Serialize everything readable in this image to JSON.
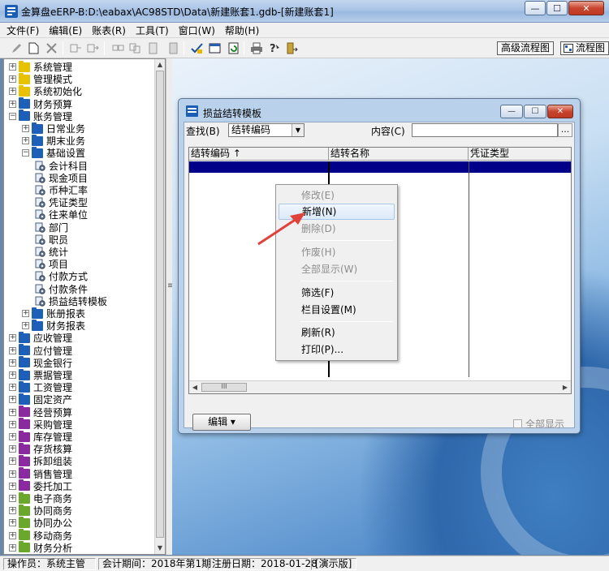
{
  "window": {
    "title": "金算盘eERP-B:D:\\eabax\\AC98STD\\Data\\新建账套1.gdb-[新建账套1]",
    "min_label": "—",
    "max_label": "☐",
    "close_label": "✕"
  },
  "menu": {
    "items": [
      {
        "label": "文件(F)"
      },
      {
        "label": "编辑(E)"
      },
      {
        "label": "账表(R)"
      },
      {
        "label": "工具(T)"
      },
      {
        "label": "窗口(W)"
      },
      {
        "label": "帮助(H)"
      }
    ]
  },
  "toolbar": {
    "advanced_flow_label": "高级流程图",
    "flow_label": "流程图"
  },
  "tree": {
    "items": [
      {
        "label": "系统管理",
        "color": "#e8c200",
        "expanded": false,
        "level": 0
      },
      {
        "label": "管理模式",
        "color": "#e8c200",
        "expanded": false,
        "level": 0
      },
      {
        "label": "系统初始化",
        "color": "#e8c200",
        "expanded": false,
        "level": 0
      },
      {
        "label": "财务预算",
        "color": "#1e5fb8",
        "expanded": false,
        "level": 0
      },
      {
        "label": "账务管理",
        "color": "#1e5fb8",
        "expanded": true,
        "level": 0
      },
      {
        "label": "日常业务",
        "color": "#1e5fb8",
        "expanded": false,
        "level": 1
      },
      {
        "label": "期末业务",
        "color": "#1e5fb8",
        "expanded": false,
        "level": 1
      },
      {
        "label": "基础设置",
        "color": "#1e5fb8",
        "expanded": true,
        "level": 1
      },
      {
        "label": "会计科目",
        "level": 2
      },
      {
        "label": "现金项目",
        "level": 2
      },
      {
        "label": "币种汇率",
        "level": 2
      },
      {
        "label": "凭证类型",
        "level": 2
      },
      {
        "label": "往来单位",
        "level": 2
      },
      {
        "label": "部门",
        "level": 2
      },
      {
        "label": "职员",
        "level": 2
      },
      {
        "label": "统计",
        "level": 2
      },
      {
        "label": "项目",
        "level": 2
      },
      {
        "label": "付款方式",
        "level": 2
      },
      {
        "label": "付款条件",
        "level": 2
      },
      {
        "label": "损益结转模板",
        "level": 2
      },
      {
        "label": "账册报表",
        "color": "#1e5fb8",
        "expanded": false,
        "level": 1
      },
      {
        "label": "财务报表",
        "color": "#1e5fb8",
        "expanded": false,
        "level": 1
      },
      {
        "label": "应收管理",
        "color": "#1e5fb8",
        "expanded": false,
        "level": 0
      },
      {
        "label": "应付管理",
        "color": "#1e5fb8",
        "expanded": false,
        "level": 0
      },
      {
        "label": "现金银行",
        "color": "#1e5fb8",
        "expanded": false,
        "level": 0
      },
      {
        "label": "票据管理",
        "color": "#1e5fb8",
        "expanded": false,
        "level": 0
      },
      {
        "label": "工资管理",
        "color": "#1e5fb8",
        "expanded": false,
        "level": 0
      },
      {
        "label": "固定资产",
        "color": "#1e5fb8",
        "expanded": false,
        "level": 0
      },
      {
        "label": "经营预算",
        "color": "#8b2aa0",
        "expanded": false,
        "level": 0
      },
      {
        "label": "采购管理",
        "color": "#8b2aa0",
        "expanded": false,
        "level": 0
      },
      {
        "label": "库存管理",
        "color": "#8b2aa0",
        "expanded": false,
        "level": 0
      },
      {
        "label": "存货核算",
        "color": "#8b2aa0",
        "expanded": false,
        "level": 0
      },
      {
        "label": "拆卸组装",
        "color": "#8b2aa0",
        "expanded": false,
        "level": 0
      },
      {
        "label": "销售管理",
        "color": "#8b2aa0",
        "expanded": false,
        "level": 0
      },
      {
        "label": "委托加工",
        "color": "#8b2aa0",
        "expanded": false,
        "level": 0
      },
      {
        "label": "电子商务",
        "color": "#6aa82c",
        "expanded": false,
        "level": 0
      },
      {
        "label": "协同商务",
        "color": "#6aa82c",
        "expanded": false,
        "level": 0
      },
      {
        "label": "协同办公",
        "color": "#6aa82c",
        "expanded": false,
        "level": 0
      },
      {
        "label": "移动商务",
        "color": "#6aa82c",
        "expanded": false,
        "level": 0
      },
      {
        "label": "财务分析",
        "color": "#6aa82c",
        "expanded": false,
        "level": 0
      }
    ]
  },
  "dialog": {
    "title": "损益结转模板",
    "search_label": "查找(B)",
    "search_field_value": "结转编码",
    "content_label": "内容(C)",
    "content_value": "",
    "ellipsis": "...",
    "columns": [
      "结转编码 ↑",
      "结转名称",
      "凭证类型"
    ],
    "scroll_grip": "III",
    "edit_button": "编辑 ▾",
    "show_all_label": "全部显示"
  },
  "context_menu": {
    "items": [
      {
        "label": "修改(E)",
        "enabled": false
      },
      {
        "label": "新增(N)",
        "enabled": true,
        "hover": true
      },
      {
        "label": "删除(D)",
        "enabled": false
      },
      {
        "label": "作废(H)",
        "enabled": false
      },
      {
        "label": "全部显示(W)",
        "enabled": false
      },
      {
        "label": "筛选(F)",
        "enabled": true
      },
      {
        "label": "栏目设置(M)",
        "enabled": true
      },
      {
        "label": "刷新(R)",
        "enabled": true
      },
      {
        "label": "打印(P)...",
        "enabled": true
      }
    ]
  },
  "statusbar": {
    "operator": "操作员：系统主管",
    "period": "会计期间：2018年第1期",
    "register_date": "注册日期：2018-01-28",
    "edition": "[演示版]"
  },
  "colors": {
    "selection": "#000088",
    "annotation_arrow": "#e0413a"
  }
}
